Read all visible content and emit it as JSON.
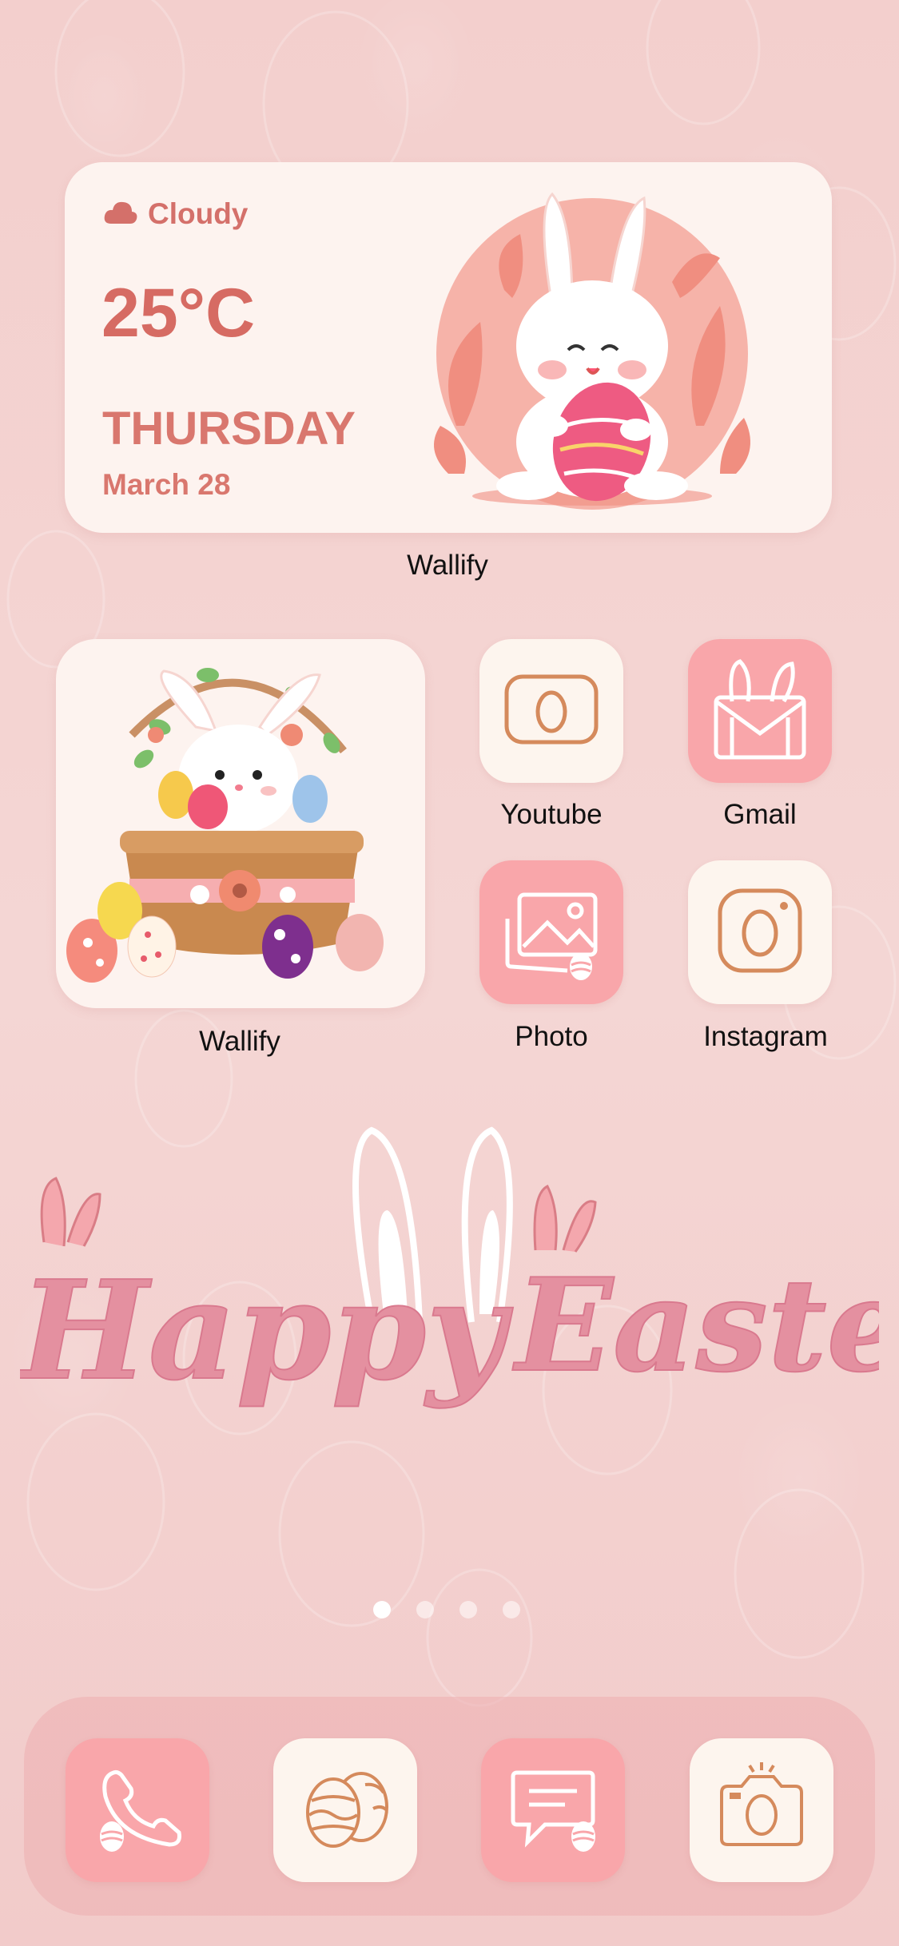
{
  "weather_widget": {
    "condition": "Cloudy",
    "temperature": "25°C",
    "day": "THURSDAY",
    "date": "March 28",
    "label": "Wallify"
  },
  "photo_widget": {
    "label": "Wallify"
  },
  "apps": [
    {
      "name": "Youtube",
      "icon": "egg-rectangle-icon",
      "style": "cream"
    },
    {
      "name": "Gmail",
      "icon": "bunny-mail-icon",
      "style": "pink"
    },
    {
      "name": "Photo",
      "icon": "photo-gallery-icon",
      "style": "pink"
    },
    {
      "name": "Instagram",
      "icon": "camera-egg-icon",
      "style": "cream"
    }
  ],
  "wallpaper_text": {
    "left": "Happy",
    "right": "Easter"
  },
  "page_indicator": {
    "pages": 4,
    "active": 1
  },
  "dock": [
    {
      "name": "Phone",
      "icon": "phone-icon"
    },
    {
      "name": "Easter Eggs",
      "icon": "easter-eggs-icon"
    },
    {
      "name": "Messages",
      "icon": "message-icon"
    },
    {
      "name": "Camera",
      "icon": "camera-icon"
    }
  ],
  "colors": {
    "accent": "#d66b63",
    "icon_line": "#d58a5c",
    "pink_tile": "#f9a6aa",
    "cream_tile": "#fdf5ee",
    "background": "#f4d3d2"
  }
}
